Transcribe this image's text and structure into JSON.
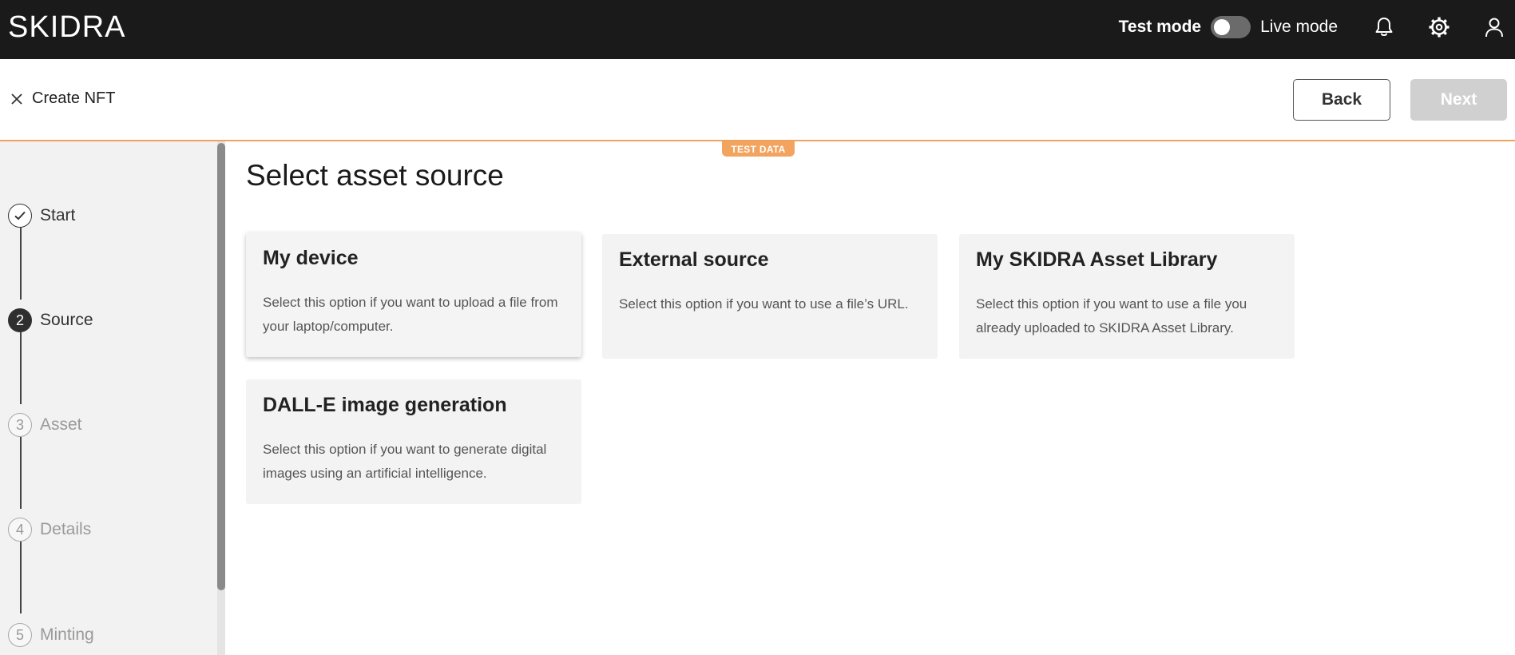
{
  "brand": {
    "logo_text": "SKIDRA"
  },
  "topbar": {
    "test_mode_label": "Test mode",
    "live_mode_label": "Live mode",
    "mode_toggle_on": false,
    "icons": [
      "bell-icon",
      "gear-icon",
      "user-icon"
    ]
  },
  "subheader": {
    "title": "Create NFT",
    "back_label": "Back",
    "next_label": "Next",
    "test_badge": "TEST DATA"
  },
  "steps": [
    {
      "number": "✓",
      "label": "Start",
      "state": "done"
    },
    {
      "number": "2",
      "label": "Source",
      "state": "active"
    },
    {
      "number": "3",
      "label": "Asset",
      "state": "pending"
    },
    {
      "number": "4",
      "label": "Details",
      "state": "pending"
    },
    {
      "number": "5",
      "label": "Minting",
      "state": "pending"
    }
  ],
  "main": {
    "title": "Select asset source",
    "cards": [
      {
        "title": "My device",
        "description": "Select this option if you want to upload a file from your laptop/computer."
      },
      {
        "title": "External source",
        "description": "Select this option if you want to use a file’s URL."
      },
      {
        "title": "My SKIDRA Asset Library",
        "description": "Select this option if you want to use a file you already uploaded to SKIDRA Asset Library."
      },
      {
        "title": "DALL-E image generation",
        "description": "Select this option if you want to generate digital images using an artificial intelligence."
      }
    ]
  },
  "colors": {
    "topbar": "#1a1a1a",
    "accent": "#f2a35e",
    "sidebar": "#f2f2f2",
    "card": "#f3f3f3"
  }
}
